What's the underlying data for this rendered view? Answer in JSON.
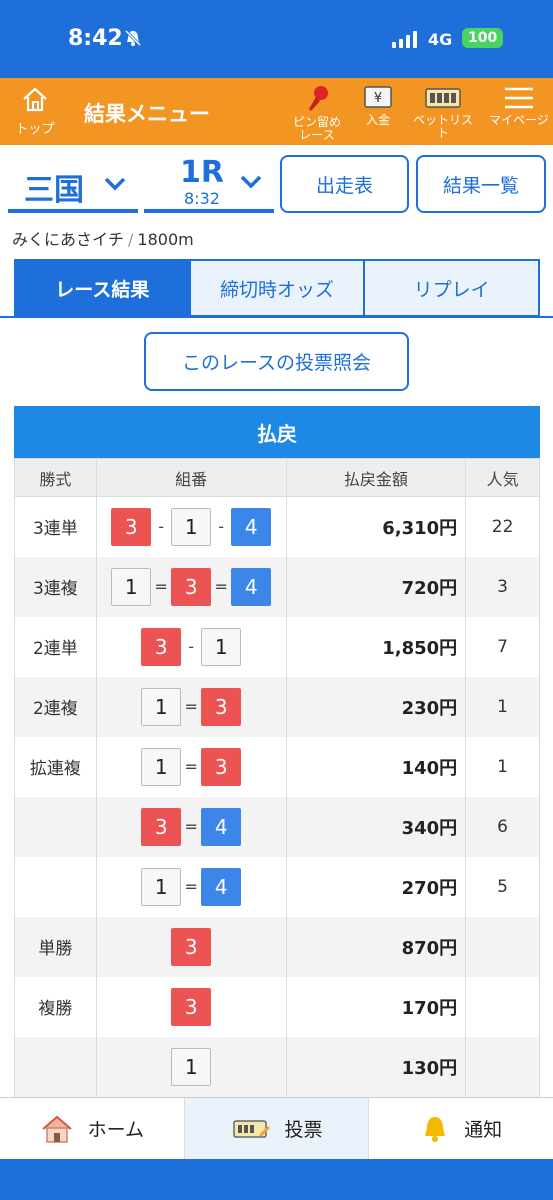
{
  "status": {
    "time": "8:42",
    "network": "4G",
    "battery": "100"
  },
  "header": {
    "home_label": "トップ",
    "title": "結果メニュー",
    "tools": [
      {
        "label": "ピン留め\nレース",
        "icon": "pin-icon"
      },
      {
        "label": "入金",
        "icon": "deposit-icon"
      },
      {
        "label": "ベットリスト",
        "icon": "betlist-icon"
      },
      {
        "label": "マイページ",
        "icon": "menu-icon"
      }
    ]
  },
  "selector": {
    "venue": "三国",
    "race": "1R",
    "race_time": "8:32",
    "entries_button": "出走表",
    "results_list_button": "結果一覧"
  },
  "race_info": {
    "name": "みくにあさイチ",
    "separator": "/",
    "distance": "1800m"
  },
  "tabs": [
    "レース結果",
    "締切時オッズ",
    "リプレイ"
  ],
  "vote_inquiry_button": "このレースの投票照会",
  "payout": {
    "title": "払戻",
    "columns": [
      "勝式",
      "組番",
      "払戻金額",
      "人気"
    ],
    "rows": [
      {
        "type": "3連単",
        "combo": [
          "3",
          "-",
          "1",
          "-",
          "4"
        ],
        "amount": "6,310円",
        "pop": "22"
      },
      {
        "type": "3連複",
        "combo": [
          "1",
          "=",
          "3",
          "=",
          "4"
        ],
        "amount": "720円",
        "pop": "3"
      },
      {
        "type": "2連単",
        "combo": [
          "3",
          "-",
          "1"
        ],
        "amount": "1,850円",
        "pop": "7"
      },
      {
        "type": "2連複",
        "combo": [
          "1",
          "=",
          "3"
        ],
        "amount": "230円",
        "pop": "1"
      },
      {
        "type": "拡連複",
        "combo": [
          "1",
          "=",
          "3"
        ],
        "amount": "140円",
        "pop": "1"
      },
      {
        "type": "",
        "combo": [
          "3",
          "=",
          "4"
        ],
        "amount": "340円",
        "pop": "6"
      },
      {
        "type": "",
        "combo": [
          "1",
          "=",
          "4"
        ],
        "amount": "270円",
        "pop": "5"
      },
      {
        "type": "単勝",
        "combo": [
          "3"
        ],
        "amount": "870円",
        "pop": ""
      },
      {
        "type": "複勝",
        "combo": [
          "3"
        ],
        "amount": "170円",
        "pop": ""
      },
      {
        "type": "",
        "combo": [
          "1"
        ],
        "amount": "130円",
        "pop": ""
      }
    ]
  },
  "bottom_nav": [
    {
      "label": "ホーム",
      "icon": "house-icon"
    },
    {
      "label": "投票",
      "icon": "ticket-icon"
    },
    {
      "label": "通知",
      "icon": "bell-icon"
    }
  ],
  "colors": {
    "primary": "#1e6fd9",
    "orange": "#f39522",
    "num3": "#ec5454",
    "num4": "#3b86e8"
  }
}
